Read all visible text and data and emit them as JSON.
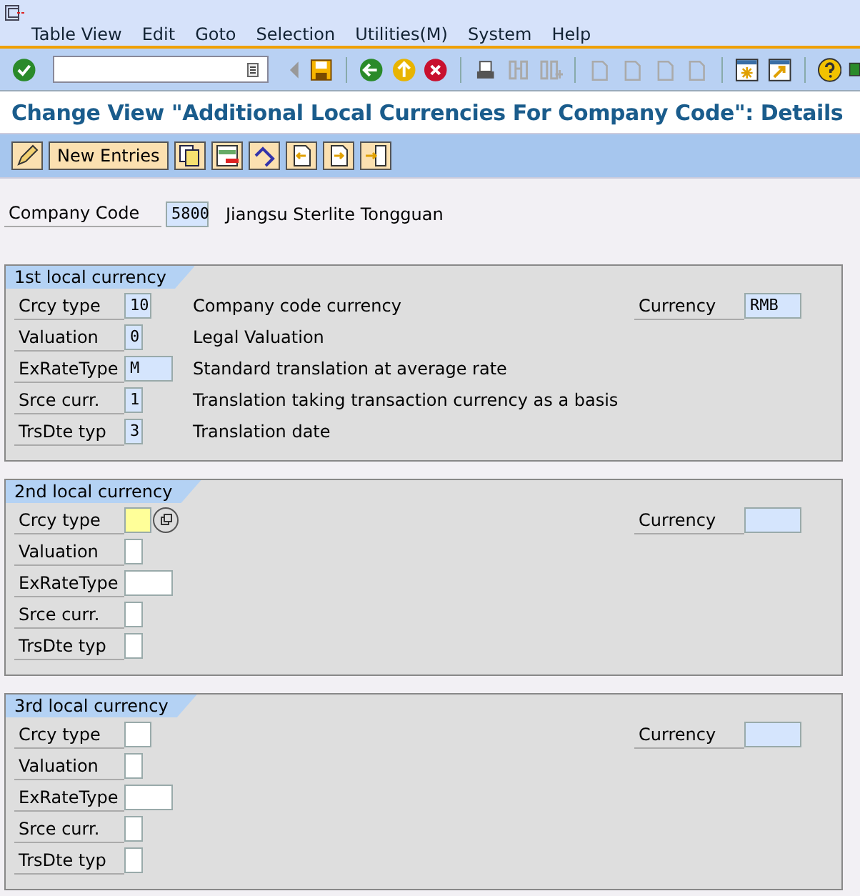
{
  "menu": [
    "Table View",
    "Edit",
    "Goto",
    "Selection",
    "Utilities(M)",
    "System",
    "Help"
  ],
  "title": "Change View \"Additional Local Currencies For Company Code\": Details",
  "app_toolbar": {
    "new_entries": "New Entries"
  },
  "company": {
    "label": "Company Code",
    "value": "5800",
    "name": "Jiangsu Sterlite Tongguan"
  },
  "groups": [
    {
      "title": "1st local currency",
      "currency": {
        "label": "Currency",
        "value": "RMB",
        "editable": false
      },
      "rows": [
        {
          "label": "Crcy type",
          "value": "10",
          "editable": false,
          "focused": false,
          "description": "Company code currency"
        },
        {
          "label": "Valuation",
          "value": "0",
          "editable": false,
          "focused": false,
          "description": "Legal Valuation"
        },
        {
          "label": "ExRateType",
          "value": "M",
          "editable": false,
          "focused": false,
          "description": "Standard translation at average rate"
        },
        {
          "label": "Srce curr.",
          "value": "1",
          "editable": false,
          "focused": false,
          "description": "Translation taking transaction currency as a basis"
        },
        {
          "label": "TrsDte typ",
          "value": "3",
          "editable": false,
          "focused": false,
          "description": "Translation date"
        }
      ]
    },
    {
      "title": "2nd local currency",
      "currency": {
        "label": "Currency",
        "editable": false
      },
      "rows": [
        {
          "label": "Crcy type",
          "editable": true,
          "focused": true
        },
        {
          "label": "Valuation",
          "editable": true,
          "focused": false
        },
        {
          "label": "ExRateType",
          "editable": true,
          "focused": false
        },
        {
          "label": "Srce curr.",
          "editable": true,
          "focused": false
        },
        {
          "label": "TrsDte typ",
          "editable": true,
          "focused": false
        }
      ]
    },
    {
      "title": "3rd local currency",
      "currency": {
        "label": "Currency",
        "editable": false
      },
      "rows": [
        {
          "label": "Crcy type",
          "editable": true,
          "focused": false
        },
        {
          "label": "Valuation",
          "editable": true,
          "focused": false
        },
        {
          "label": "ExRateType",
          "editable": true,
          "focused": false
        },
        {
          "label": "Srce curr.",
          "editable": true,
          "focused": false
        },
        {
          "label": "TrsDte typ",
          "editable": true,
          "focused": false
        }
      ]
    }
  ]
}
